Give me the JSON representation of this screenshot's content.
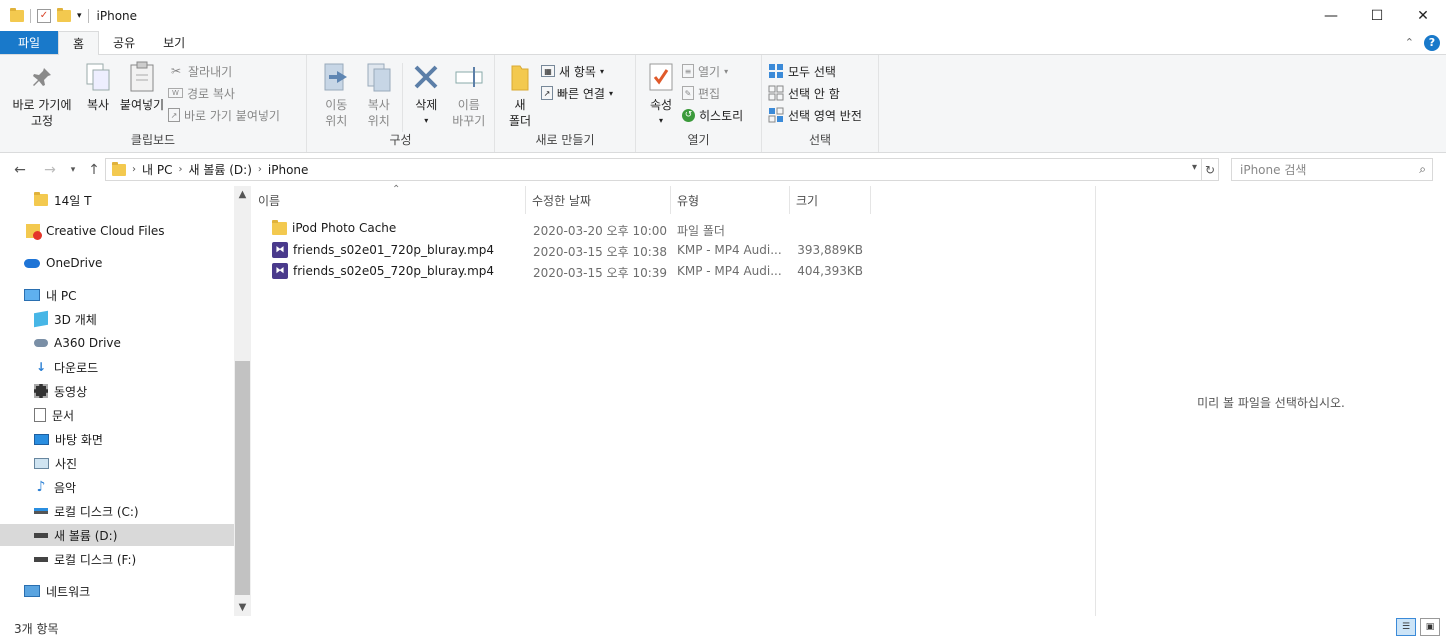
{
  "window": {
    "title": "iPhone",
    "controls": {
      "minimize": "—",
      "maximize": "☐",
      "close": "✕"
    }
  },
  "ribbon": {
    "tabs": [
      {
        "label": "파일"
      },
      {
        "label": "홈"
      },
      {
        "label": "공유"
      },
      {
        "label": "보기"
      }
    ],
    "groups": {
      "clipboard": {
        "label": "클립보드",
        "pin": "바로 가기에\n고정",
        "copy": "복사",
        "paste": "붙여넣기",
        "cut": "잘라내기",
        "copy_path": "경로 복사",
        "paste_shortcut": "바로 가기 붙여넣기"
      },
      "organize": {
        "label": "구성",
        "move": "이동\n위치",
        "copy_to": "복사\n위치",
        "delete": "삭제",
        "rename": "이름\n바꾸기"
      },
      "new": {
        "label": "새로 만들기",
        "new_folder": "새\n폴더",
        "new_item": "새 항목",
        "easy_access": "빠른 연결"
      },
      "open": {
        "label": "열기",
        "properties": "속성",
        "open": "열기",
        "edit": "편집",
        "history": "히스토리"
      },
      "select": {
        "label": "선택",
        "select_all": "모두 선택",
        "select_none": "선택 안 함",
        "invert": "선택 영역 반전"
      }
    }
  },
  "address": {
    "path": [
      "내 PC",
      "새 볼륨 (D:)",
      "iPhone"
    ],
    "search_placeholder": "iPhone 검색"
  },
  "nav": {
    "items": [
      {
        "label": "14일 T",
        "icon": "folder-icon"
      },
      {
        "label": "Creative Cloud Files",
        "icon": "creative-cloud-icon"
      },
      {
        "label": "OneDrive",
        "icon": "onedrive-icon"
      },
      {
        "label": "내 PC",
        "icon": "pc-icon"
      },
      {
        "label": "3D 개체",
        "icon": "3d-objects-icon"
      },
      {
        "label": "A360 Drive",
        "icon": "a360-icon"
      },
      {
        "label": "다운로드",
        "icon": "download-icon"
      },
      {
        "label": "동영상",
        "icon": "video-icon"
      },
      {
        "label": "문서",
        "icon": "document-icon"
      },
      {
        "label": "바탕 화면",
        "icon": "desktop-icon"
      },
      {
        "label": "사진",
        "icon": "pictures-icon"
      },
      {
        "label": "음악",
        "icon": "music-icon"
      },
      {
        "label": "로컬 디스크 (C:)",
        "icon": "drive-c-icon"
      },
      {
        "label": "새 볼륨 (D:)",
        "icon": "drive-icon"
      },
      {
        "label": "로컬 디스크 (F:)",
        "icon": "drive-icon"
      },
      {
        "label": "네트워크",
        "icon": "network-icon"
      }
    ]
  },
  "list": {
    "columns": [
      "이름",
      "수정한 날짜",
      "유형",
      "크기"
    ],
    "rows": [
      {
        "name": "iPod Photo Cache",
        "date": "2020-03-20 오후 10:00",
        "type": "파일 폴더",
        "size": "",
        "icon": "folder-icon"
      },
      {
        "name": "friends_s02e01_720p_bluray.mp4",
        "date": "2020-03-15 오후 10:38",
        "type": "KMP - MP4 Audi...",
        "size": "393,889KB",
        "icon": "kmp-video-icon"
      },
      {
        "name": "friends_s02e05_720p_bluray.mp4",
        "date": "2020-03-15 오후 10:39",
        "type": "KMP - MP4 Audi...",
        "size": "404,393KB",
        "icon": "kmp-video-icon"
      }
    ]
  },
  "preview": {
    "message": "미리 볼 파일을 선택하십시오."
  },
  "status": {
    "count": "3개 항목"
  },
  "colors": {
    "accent": "#1979ca",
    "selected": "#d9d9d9",
    "ribbon_bg": "#f5f6f7"
  }
}
